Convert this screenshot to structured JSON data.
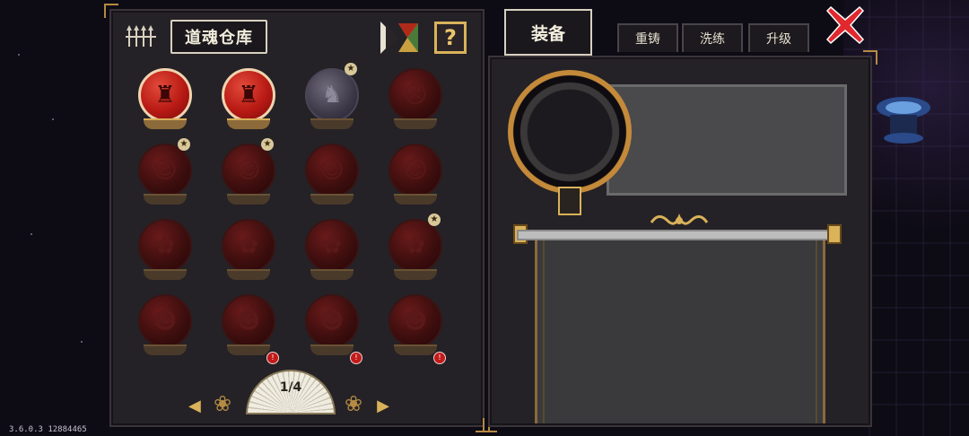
{
  "warehouse": {
    "title": "道魂仓库",
    "help_label": "?",
    "page_indicator": "1/4",
    "souls": [
      {
        "state": "active",
        "glyph": "♜",
        "star": false,
        "alert": false
      },
      {
        "state": "active",
        "glyph": "♜",
        "star": false,
        "alert": false
      },
      {
        "state": "silver",
        "glyph": "♞",
        "star": true,
        "alert": false
      },
      {
        "state": "locked",
        "glyph": "☹",
        "star": false,
        "alert": false
      },
      {
        "state": "locked",
        "glyph": "☺",
        "star": true,
        "alert": false
      },
      {
        "state": "locked",
        "glyph": "☺",
        "star": true,
        "alert": false
      },
      {
        "state": "locked",
        "glyph": "☺",
        "star": false,
        "alert": false
      },
      {
        "state": "locked",
        "glyph": "☺",
        "star": false,
        "alert": false
      },
      {
        "state": "locked",
        "glyph": "✿",
        "star": false,
        "alert": false
      },
      {
        "state": "locked",
        "glyph": "✿",
        "star": false,
        "alert": false
      },
      {
        "state": "locked",
        "glyph": "✿",
        "star": false,
        "alert": false
      },
      {
        "state": "locked",
        "glyph": "✿",
        "star": true,
        "alert": false
      },
      {
        "state": "locked",
        "glyph": "☻",
        "star": false,
        "alert": false
      },
      {
        "state": "locked",
        "glyph": "☻",
        "star": false,
        "alert": true
      },
      {
        "state": "locked",
        "glyph": "☻",
        "star": false,
        "alert": true
      },
      {
        "state": "locked",
        "glyph": "☻",
        "star": false,
        "alert": true
      }
    ]
  },
  "tabs": {
    "equip": "装备",
    "reforge": "重铸",
    "wash": "洗练",
    "upgrade": "升级"
  },
  "version": "3.6.0.3 12884465",
  "colors": {
    "panel_bg": "#242226",
    "gold_accent": "#d9b25a",
    "active_orb": "#b81a14",
    "close_red": "#e0282e"
  }
}
